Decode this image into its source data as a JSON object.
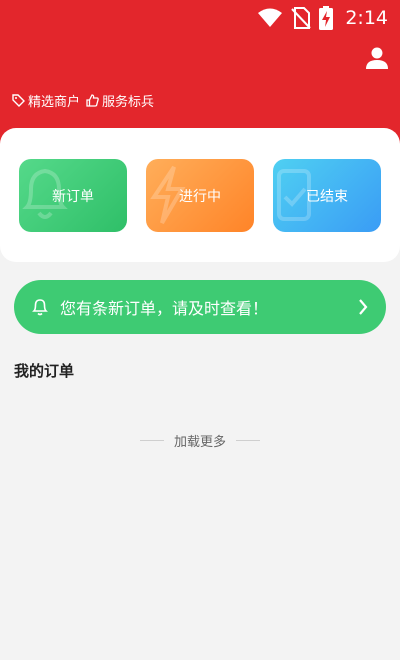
{
  "status_bar": {
    "time": "2:14",
    "icons": [
      "wifi-icon",
      "no-sim-icon",
      "battery-charging-icon"
    ]
  },
  "header": {
    "background_color": "#e3262c",
    "profile_icon": "person-icon",
    "tags": [
      {
        "icon": "tag-icon",
        "label": "精选商户"
      },
      {
        "icon": "thumbs-up-icon",
        "label": "服务标兵"
      }
    ]
  },
  "order_status": {
    "new": {
      "label": "新订单",
      "icon": "bell-icon",
      "color": "#3ccd78"
    },
    "in_progress": {
      "label": "进行中",
      "icon": "lightning-icon",
      "color": "#ff9a40"
    },
    "done": {
      "label": "已结束",
      "icon": "clipboard-check-icon",
      "color": "#42b3f4"
    }
  },
  "notice": {
    "text": "您有条新订单，请及时查看！",
    "icon": "bell-icon",
    "chevron": "chevron-right-icon",
    "color": "#3ecb73"
  },
  "my_orders": {
    "title": "我的订单",
    "load_more": "加载更多"
  }
}
